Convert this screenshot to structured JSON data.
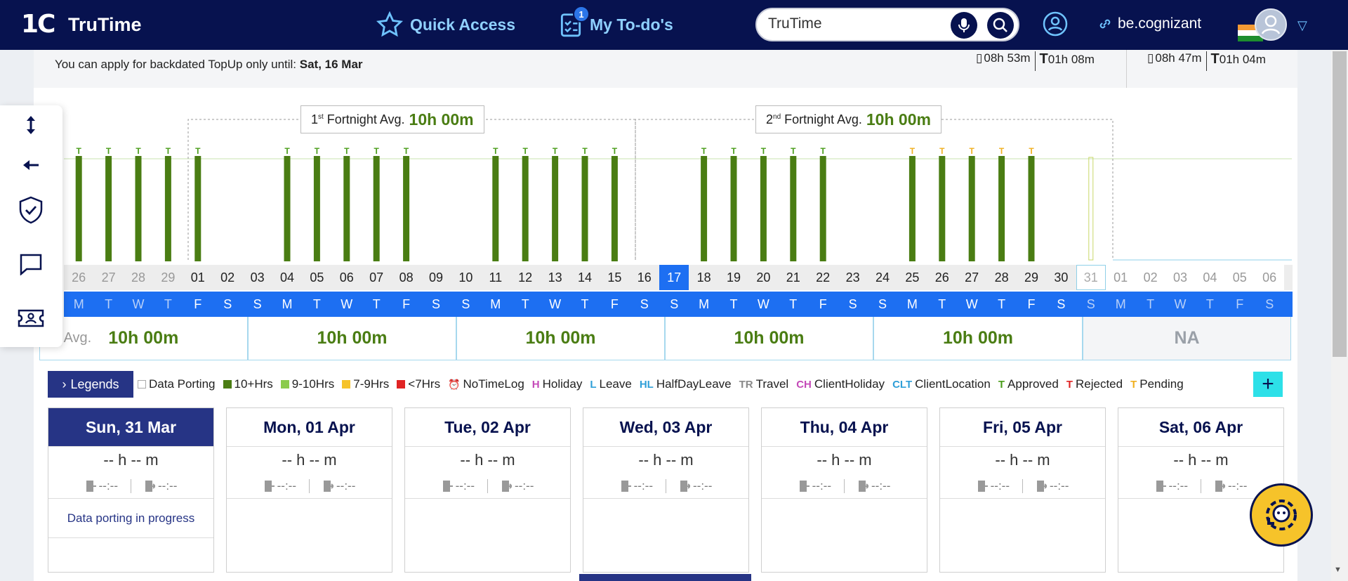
{
  "app": {
    "logo_mark": "1C",
    "logo_text": "TruTime"
  },
  "nav": {
    "quick_access": "Quick Access",
    "todos": "My To-do's",
    "todo_count": "1",
    "search_value": "TruTime",
    "be_link": "be.cognizant"
  },
  "info": {
    "backdate_prefix": "You can apply for backdated TopUp only until: ",
    "backdate_date": "Sat, 16 Mar",
    "summary1_a": "08h 53m",
    "summary1_b": "01h 08m",
    "summary2_a": "08h 47m",
    "summary2_b": "01h 04m",
    "t_mark": "T"
  },
  "fortnight": {
    "first_sup": "st",
    "first_num": "1",
    "second_num": "2",
    "second_sup": "nd",
    "label": " Fortnight Avg.",
    "first_value": "10h 00m",
    "second_value": "10h 00m"
  },
  "chart_data": {
    "type": "bar",
    "dates": [
      "26",
      "27",
      "28",
      "29",
      "01",
      "02",
      "03",
      "04",
      "05",
      "06",
      "07",
      "08",
      "09",
      "10",
      "11",
      "12",
      "13",
      "14",
      "15",
      "16",
      "17",
      "18",
      "19",
      "20",
      "21",
      "22",
      "23",
      "24",
      "25",
      "26",
      "27",
      "28",
      "29",
      "30",
      "31",
      "01",
      "02",
      "03",
      "04",
      "05",
      "06"
    ],
    "days": [
      "M",
      "T",
      "W",
      "T",
      "F",
      "S",
      "S",
      "M",
      "T",
      "W",
      "T",
      "F",
      "S",
      "S",
      "M",
      "T",
      "W",
      "T",
      "F",
      "S",
      "S",
      "M",
      "T",
      "W",
      "T",
      "F",
      "S",
      "S",
      "M",
      "T",
      "W",
      "T",
      "F",
      "S",
      "S",
      "M",
      "T",
      "W",
      "T",
      "F",
      "S"
    ],
    "bars": [
      1,
      1,
      1,
      1,
      1,
      0,
      0,
      1,
      1,
      1,
      1,
      1,
      0,
      0,
      1,
      1,
      1,
      1,
      1,
      0,
      0,
      1,
      1,
      1,
      1,
      1,
      0,
      0,
      1,
      1,
      1,
      1,
      1,
      0,
      0,
      0,
      0,
      0,
      0,
      0,
      0
    ],
    "status": [
      "approved",
      "approved",
      "approved",
      "approved",
      "approved",
      "",
      "",
      "approved",
      "approved",
      "approved",
      "approved",
      "approved",
      "",
      "",
      "approved",
      "approved",
      "approved",
      "approved",
      "approved",
      "",
      "",
      "approved",
      "approved",
      "approved",
      "approved",
      "approved",
      "",
      "",
      "pending",
      "pending",
      "pending",
      "pending",
      "pending",
      "",
      "",
      "",
      "",
      "",
      "",
      "",
      ""
    ],
    "bar_category": "10+Hrs",
    "today_index": 20,
    "porting_index": 34,
    "colors": {
      "bar": "#4a7d13",
      "approved": "#4a9d1a",
      "pending": "#f0b020",
      "today": "#1d6ff2"
    }
  },
  "weeks": {
    "label_partial": "ek Avg.",
    "values": [
      "10h 00m",
      "10h 00m",
      "10h 00m",
      "10h 00m",
      "10h 00m"
    ],
    "na": "NA"
  },
  "legends": {
    "button": "Legends",
    "items": [
      {
        "label": "Data Porting",
        "color": "#ffffff"
      },
      {
        "label": "10+Hrs",
        "color": "#4a7d13"
      },
      {
        "label": "9-10Hrs",
        "color": "#8bcb4c"
      },
      {
        "label": "7-9Hrs",
        "color": "#f6c32a"
      },
      {
        "label": "<7Hrs",
        "color": "#e02424"
      }
    ],
    "notimelog": "NoTimeLog",
    "codes": [
      {
        "code": "H",
        "label": "Holiday",
        "color": "#c44ab8"
      },
      {
        "code": "L",
        "label": "Leave",
        "color": "#2f9fd8"
      },
      {
        "code": "HL",
        "label": "HalfDayLeave",
        "color": "#2f9fd8"
      },
      {
        "code": "TR",
        "label": "Travel",
        "color": "#8a8a8a"
      },
      {
        "code": "CH",
        "label": "ClientHoliday",
        "color": "#c44ab8"
      },
      {
        "code": "CLT",
        "label": "ClientLocation",
        "color": "#2f9fd8"
      },
      {
        "code": "T",
        "label": "Approved",
        "color": "#4a9d1a"
      },
      {
        "code": "T",
        "label": "Rejected",
        "color": "#e02424"
      },
      {
        "code": "T",
        "label": "Pending",
        "color": "#f0b020"
      }
    ]
  },
  "cards": [
    {
      "title": "Sun, 31 Mar",
      "hours": "-- h -- m",
      "in": "--:--",
      "out": "--:--",
      "msg": "Data porting in progress"
    },
    {
      "title": "Mon, 01 Apr",
      "hours": "-- h -- m",
      "in": "--:--",
      "out": "--:--",
      "msg": ""
    },
    {
      "title": "Tue, 02 Apr",
      "hours": "-- h -- m",
      "in": "--:--",
      "out": "--:--",
      "msg": ""
    },
    {
      "title": "Wed, 03 Apr",
      "hours": "-- h -- m",
      "in": "--:--",
      "out": "--:--",
      "msg": ""
    },
    {
      "title": "Thu, 04 Apr",
      "hours": "-- h -- m",
      "in": "--:--",
      "out": "--:--",
      "msg": ""
    },
    {
      "title": "Fri, 05 Apr",
      "hours": "-- h -- m",
      "in": "--:--",
      "out": "--:--",
      "msg": ""
    },
    {
      "title": "Sat, 06 Apr",
      "hours": "-- h -- m",
      "in": "--:--",
      "out": "--:--",
      "msg": ""
    }
  ]
}
